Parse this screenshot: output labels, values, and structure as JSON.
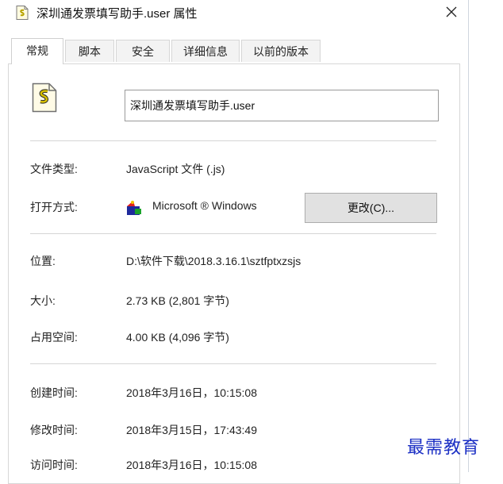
{
  "window": {
    "title": "深圳通发票填写助手.user 属性",
    "close_icon": "close-icon",
    "file_icon": "javascript-file-icon"
  },
  "tabs": [
    {
      "label": "常规",
      "active": true
    },
    {
      "label": "脚本",
      "active": false
    },
    {
      "label": "安全",
      "active": false
    },
    {
      "label": "详细信息",
      "active": false
    },
    {
      "label": "以前的版本",
      "active": false
    }
  ],
  "general": {
    "file_name": "深圳通发票填写助手.user",
    "type_label": "文件类型:",
    "type_value": "JavaScript 文件 (.js)",
    "opens_with_label": "打开方式:",
    "opens_with_value": "Microsoft ® Windows",
    "opens_with_icon": "windows-script-host-icon",
    "change_button": "更改(C)...",
    "location_label": "位置:",
    "location_value": "D:\\软件下载\\2018.3.16.1\\sztfptxzsjs",
    "size_label": "大小:",
    "size_value": "2.73 KB (2,801 字节)",
    "size_on_disk_label": "占用空间:",
    "size_on_disk_value": "4.00 KB (4,096 字节)",
    "created_label": "创建时间:",
    "created_value": "2018年3月16日，10:15:08",
    "modified_label": "修改时间:",
    "modified_value": "2018年3月15日，17:43:49",
    "accessed_label": "访问时间:",
    "accessed_value": "2018年3月16日，10:15:08"
  },
  "watermark": "最需教育",
  "colors": {
    "watermark": "#1b2fc4",
    "button_face": "#e1e1e1",
    "divider": "#d5d5d5"
  }
}
